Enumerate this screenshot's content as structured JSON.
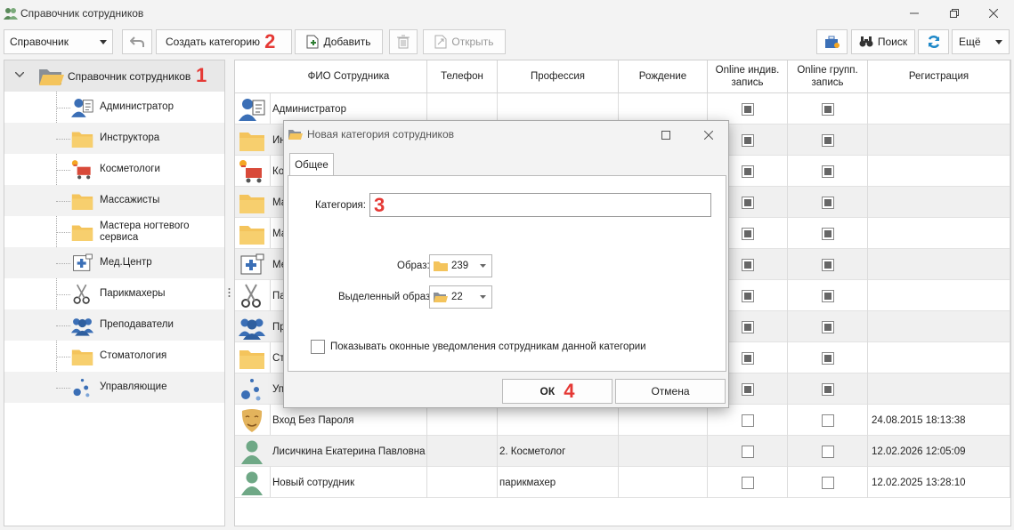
{
  "window": {
    "title": "Справочник сотрудников"
  },
  "toolbar": {
    "dropdown_value": "Справочник",
    "create_category_label": "Создать категорию",
    "create_category_badge": "2",
    "add_label": "Добавить",
    "open_label": "Открыть",
    "search_label": "Поиск",
    "more_label": "Ещё"
  },
  "tree": {
    "root_label": "Справочник сотрудников",
    "root_badge": "1",
    "items": [
      {
        "label": "Администратор",
        "icon": "admin-icon"
      },
      {
        "label": "Инструктора",
        "icon": "folder-icon"
      },
      {
        "label": "Косметологи",
        "icon": "cart-icon"
      },
      {
        "label": "Массажисты",
        "icon": "folder-icon"
      },
      {
        "label": "Мастера ногтевого сервиса",
        "icon": "folder-icon"
      },
      {
        "label": "Мед.Центр",
        "icon": "medical-icon"
      },
      {
        "label": "Парикмахеры",
        "icon": "scissors-icon"
      },
      {
        "label": "Преподаватели",
        "icon": "group-icon"
      },
      {
        "label": "Стоматология",
        "icon": "folder-icon"
      },
      {
        "label": "Управляющие",
        "icon": "dots-icon"
      }
    ]
  },
  "grid": {
    "columns": [
      "ФИО Сотрудника",
      "Телефон",
      "Профессия",
      "Рождение",
      "Online индив. запись",
      "Online групп. запись",
      "Регистрация"
    ],
    "rows": [
      {
        "name": "Администратор",
        "phone": "",
        "profession": "",
        "birth": "",
        "ind": true,
        "grp": true,
        "reg": ""
      },
      {
        "name": "Ин",
        "phone": "",
        "profession": "",
        "birth": "",
        "ind": true,
        "grp": true,
        "reg": ""
      },
      {
        "name": "Ко",
        "phone": "",
        "profession": "",
        "birth": "",
        "ind": true,
        "grp": true,
        "reg": ""
      },
      {
        "name": "Ма",
        "phone": "",
        "profession": "",
        "birth": "",
        "ind": true,
        "grp": true,
        "reg": ""
      },
      {
        "name": "Ма",
        "phone": "",
        "profession": "",
        "birth": "",
        "ind": true,
        "grp": true,
        "reg": ""
      },
      {
        "name": "Ме",
        "phone": "",
        "profession": "",
        "birth": "",
        "ind": true,
        "grp": true,
        "reg": ""
      },
      {
        "name": "Па",
        "phone": "",
        "profession": "",
        "birth": "",
        "ind": true,
        "grp": true,
        "reg": ""
      },
      {
        "name": "Пр",
        "phone": "",
        "profession": "",
        "birth": "",
        "ind": true,
        "grp": true,
        "reg": ""
      },
      {
        "name": "Ст",
        "phone": "",
        "profession": "",
        "birth": "",
        "ind": true,
        "grp": true,
        "reg": ""
      },
      {
        "name": "Уп",
        "phone": "",
        "profession": "",
        "birth": "",
        "ind": true,
        "grp": true,
        "reg": ""
      },
      {
        "name": "Вход Без Пароля",
        "phone": "",
        "profession": "",
        "birth": "",
        "ind": false,
        "grp": false,
        "reg": "24.08.2015 18:13:38"
      },
      {
        "name": "Лисичкина Екатерина Павловна",
        "phone": "",
        "profession": "2. Косметолог",
        "birth": "",
        "ind": false,
        "grp": false,
        "reg": "12.02.2026 12:05:09"
      },
      {
        "name": "Новый сотрудник",
        "phone": "",
        "profession": "парикмахер",
        "birth": "",
        "ind": false,
        "grp": false,
        "reg": "12.02.2025 13:28:10"
      }
    ]
  },
  "dialog": {
    "title": "Новая категория сотрудников",
    "tab_label": "Общее",
    "category_label": "Категория:",
    "category_badge": "3",
    "category_value": "",
    "image_label": "Образ:",
    "image_value": "239",
    "selected_image_label": "Выделенный образ:",
    "selected_image_value": "22",
    "notify_label": "Показывать оконные уведомления сотрудникам данной категории",
    "ok_label": "ОК",
    "ok_badge": "4",
    "cancel_label": "Отмена"
  },
  "colors": {
    "badge": "#e53935",
    "folder": "#f4c45c",
    "accent_blue": "#3b6fb6"
  }
}
